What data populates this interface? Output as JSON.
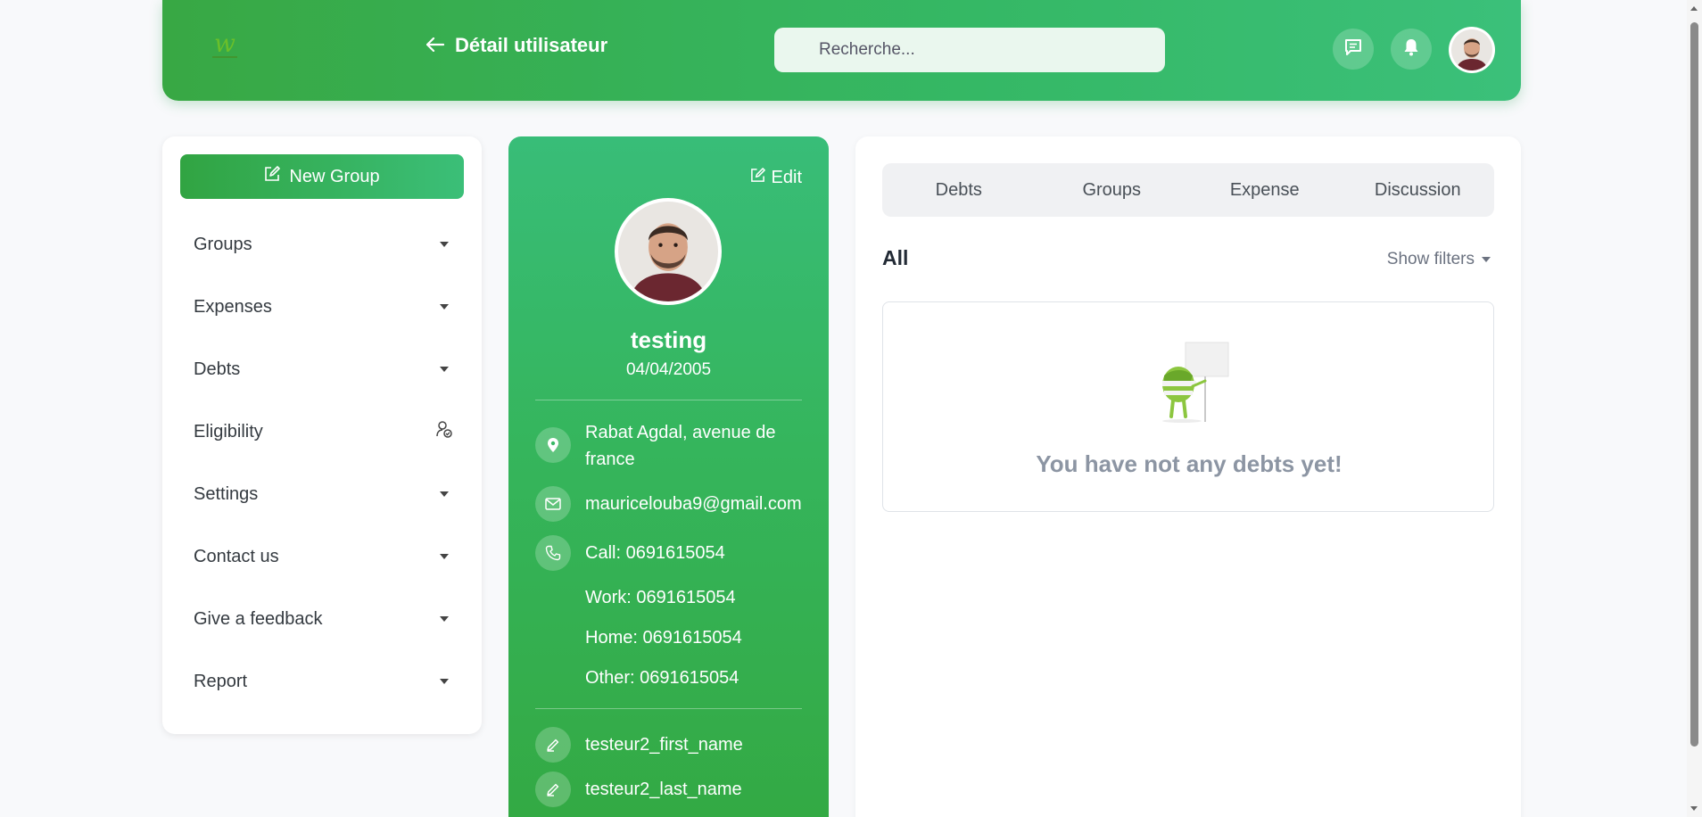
{
  "header": {
    "title": "Détail utilisateur",
    "search_placeholder": "Recherche...",
    "logo_text": "W"
  },
  "sidebar": {
    "new_group_label": "New Group",
    "items": [
      {
        "label": "Groups"
      },
      {
        "label": "Expenses"
      },
      {
        "label": "Debts"
      },
      {
        "label": "Eligibility"
      },
      {
        "label": "Settings"
      },
      {
        "label": "Contact us"
      },
      {
        "label": "Give a feedback"
      },
      {
        "label": "Report"
      }
    ]
  },
  "profile": {
    "edit_label": "Edit",
    "name": "testing",
    "birthdate": "04/04/2005",
    "address": "Rabat Agdal, avenue de france",
    "email": "mauricelouba9@gmail.com",
    "phone_call": "Call: 0691615054",
    "phone_work": "Work: 0691615054",
    "phone_home": "Home: 0691615054",
    "phone_other": "Other: 0691615054",
    "first_name": "testeur2_first_name",
    "last_name": "testeur2_last_name"
  },
  "main": {
    "tabs": [
      {
        "label": "Debts"
      },
      {
        "label": "Groups"
      },
      {
        "label": "Expense"
      },
      {
        "label": "Discussion"
      }
    ],
    "filter_title": "All",
    "show_filters_label": "Show filters",
    "empty_message": "You have not any debts yet!"
  },
  "colors": {
    "brand_green": "#35b55c",
    "brand_green_light": "#3bc07a"
  }
}
